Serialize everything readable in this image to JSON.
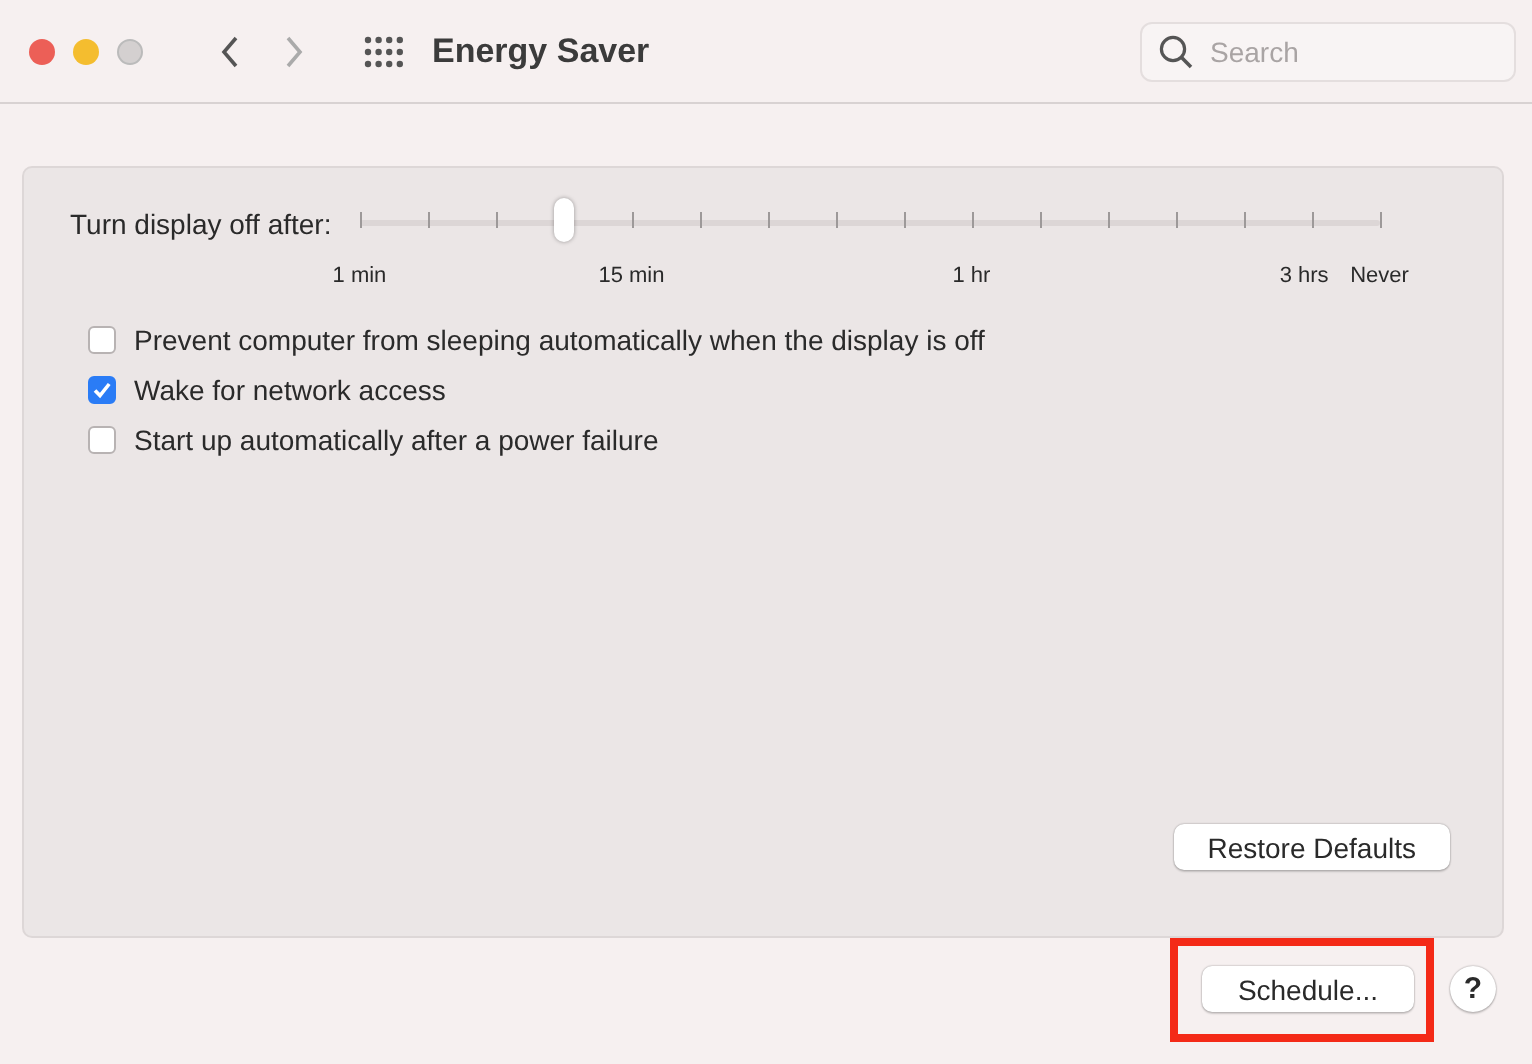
{
  "window": {
    "title": "Energy Saver"
  },
  "search": {
    "placeholder": "Search"
  },
  "display_sleep": {
    "label": "Turn display off after:",
    "level": 0.2,
    "scale_labels": [
      "1 min",
      "15 min",
      "1 hr",
      "3 hrs",
      "Never"
    ]
  },
  "options": [
    {
      "label": "Prevent computer from sleeping automatically when the display is off",
      "checked": false
    },
    {
      "label": "Wake for network access",
      "checked": true
    },
    {
      "label": "Start up automatically after a power failure",
      "checked": false
    }
  ],
  "buttons": {
    "restore": "Restore Defaults",
    "schedule": {
      "label": "Schedule...",
      "highlighted": true
    },
    "help": "?"
  }
}
